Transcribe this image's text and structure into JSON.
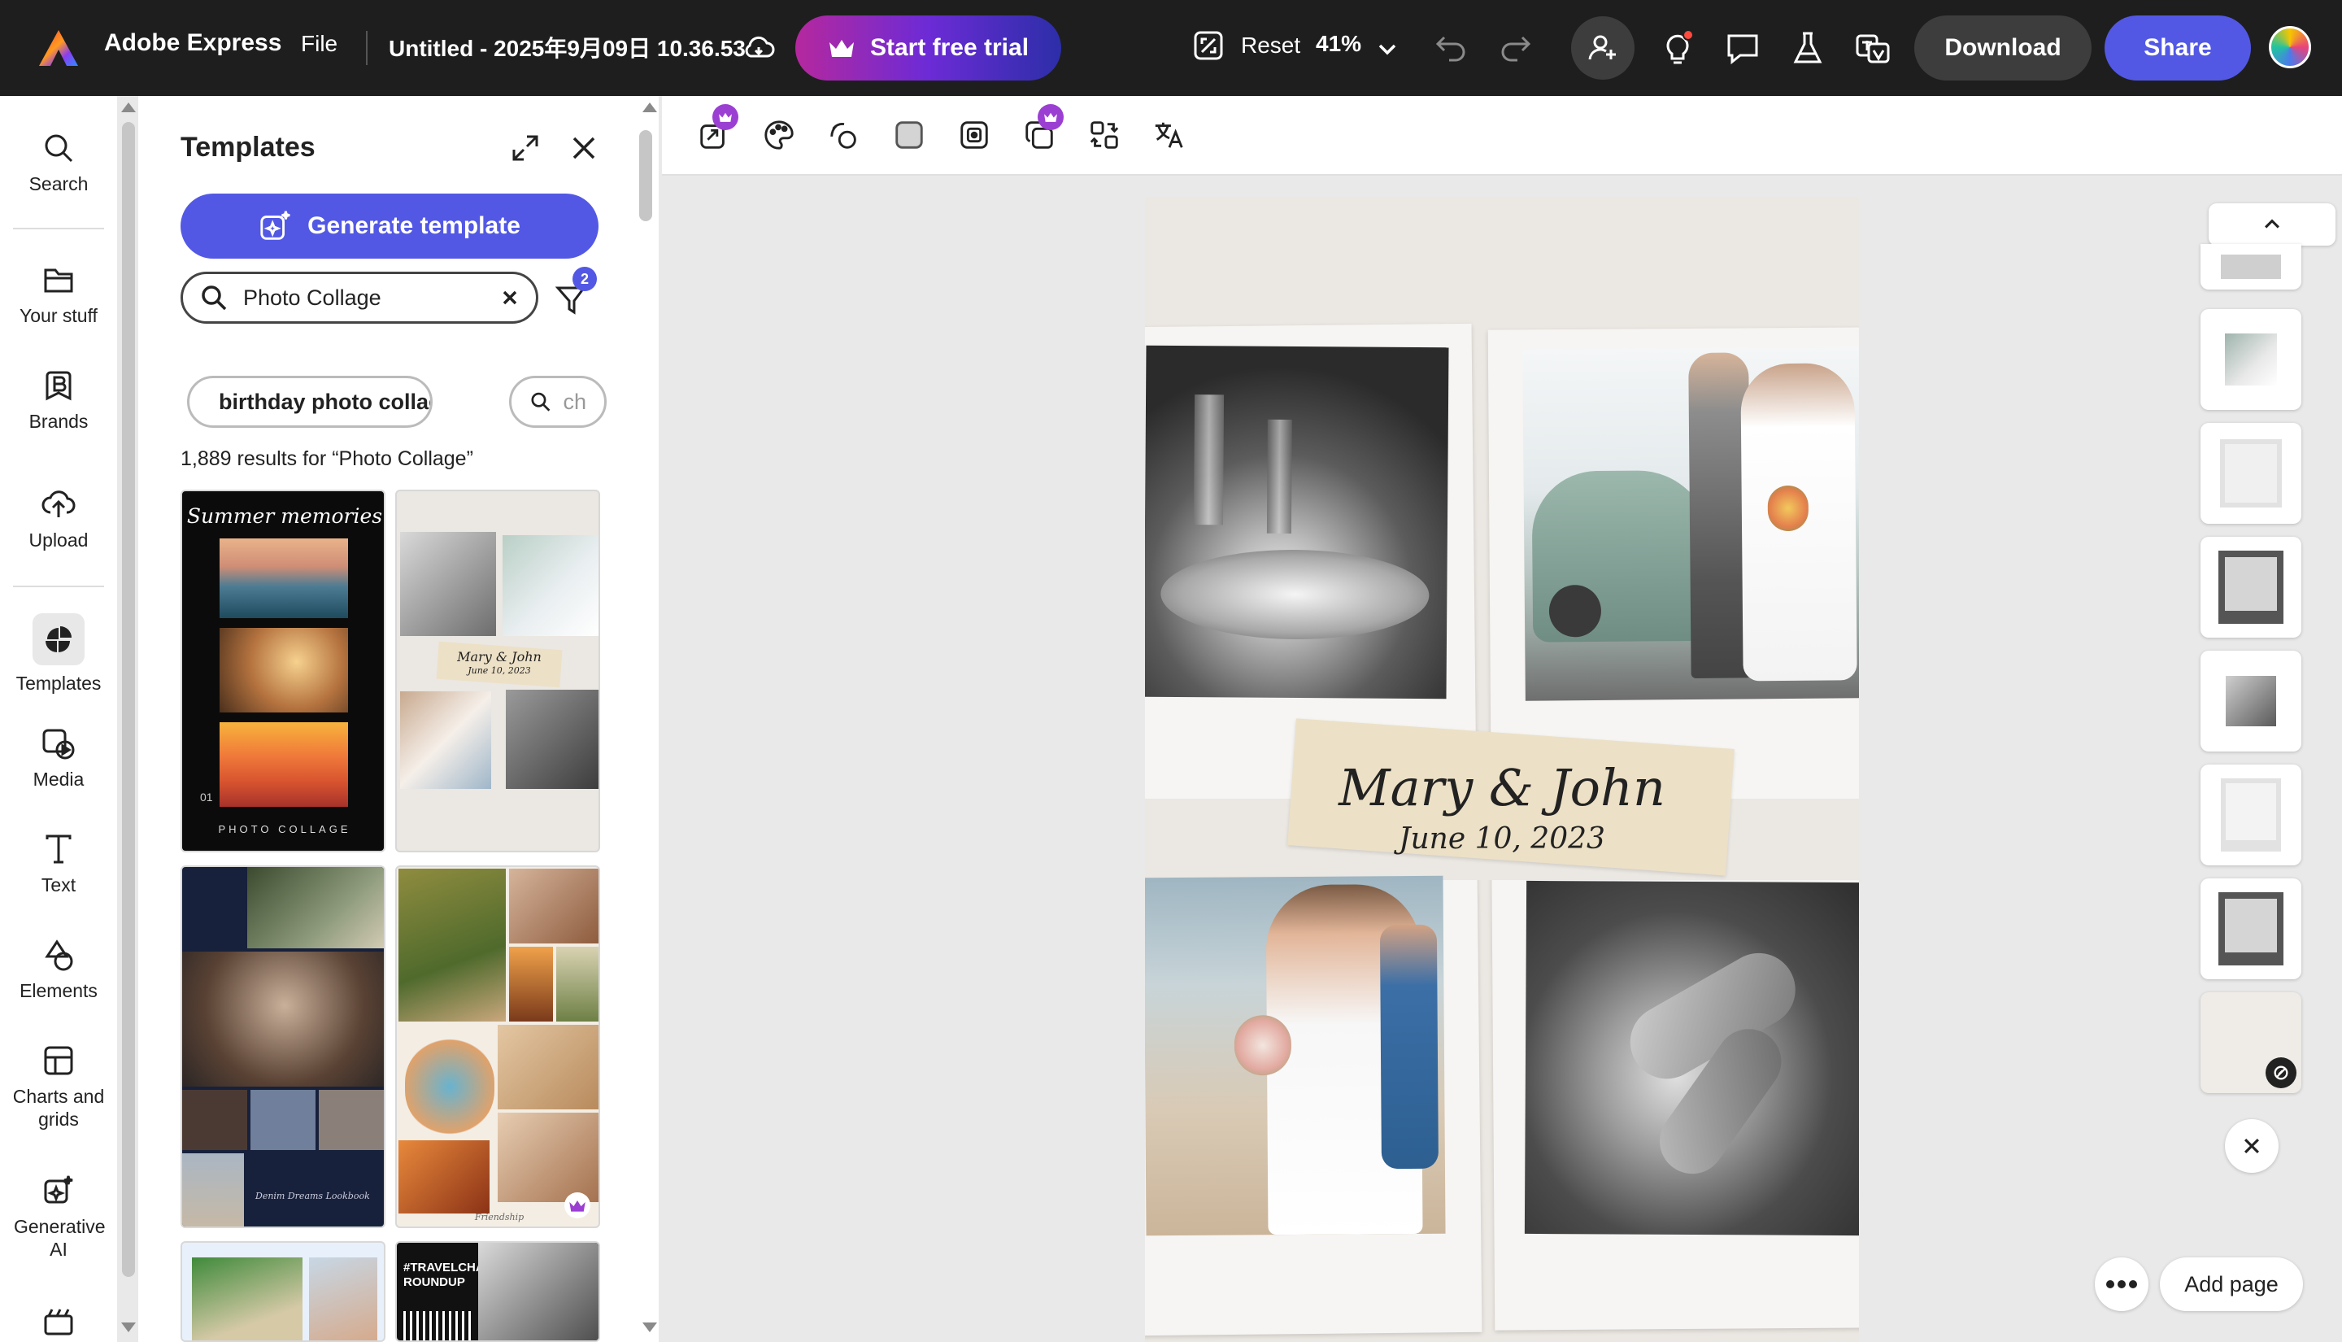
{
  "app": {
    "name": "Adobe Express",
    "file_menu": "File",
    "doc_title": "Untitled - 2025年9月09日 10.36.53"
  },
  "topbar": {
    "trial_label": "Start free trial",
    "reset_label": "Reset",
    "zoom": "41%",
    "download_label": "Download",
    "share_label": "Share"
  },
  "rail": [
    {
      "label": "Search",
      "icon": "search-icon"
    },
    {
      "label": "Your stuff",
      "icon": "folder-icon"
    },
    {
      "label": "Brands",
      "icon": "brand-icon"
    },
    {
      "label": "Upload",
      "icon": "upload-icon"
    },
    {
      "label": "Templates",
      "icon": "templates-icon",
      "selected": true
    },
    {
      "label": "Media",
      "icon": "media-icon"
    },
    {
      "label": "Text",
      "icon": "text-icon"
    },
    {
      "label": "Elements",
      "icon": "elements-icon"
    },
    {
      "label": "Charts and grids",
      "icon": "charts-icon"
    },
    {
      "label": "Generative AI",
      "icon": "generative-ai-icon"
    }
  ],
  "panel": {
    "title": "Templates",
    "generate_label": "Generate template",
    "search_value": "Photo Collage",
    "filter_count": "2",
    "chips": [
      "birthday photo collage",
      "ch"
    ],
    "results_text": "1,889 results for “Photo Collage”",
    "thumbs": [
      {
        "title": "Summer memories",
        "footer": "PHOTO COLLAGE",
        "num": "01"
      },
      {
        "title": "Mary & John",
        "sub": "June 10, 2023"
      },
      {
        "caption": "Denim Dreams Lookbook"
      },
      {
        "caption": "Friendship"
      },
      {},
      {
        "title": "#TRAVELCHALLENGE ROUNDUP"
      }
    ]
  },
  "canvas": {
    "names": "Mary & John",
    "date": "June 10, 2023"
  },
  "strip": {
    "add_page_label": "Add page"
  },
  "colors": {
    "topbar": "#1e1e1e",
    "accent": "#5258e4",
    "trial_gradient_start": "#b5289e",
    "trial_gradient_end": "#2c2ea8",
    "canvas_bg": "#ebe7e2"
  }
}
